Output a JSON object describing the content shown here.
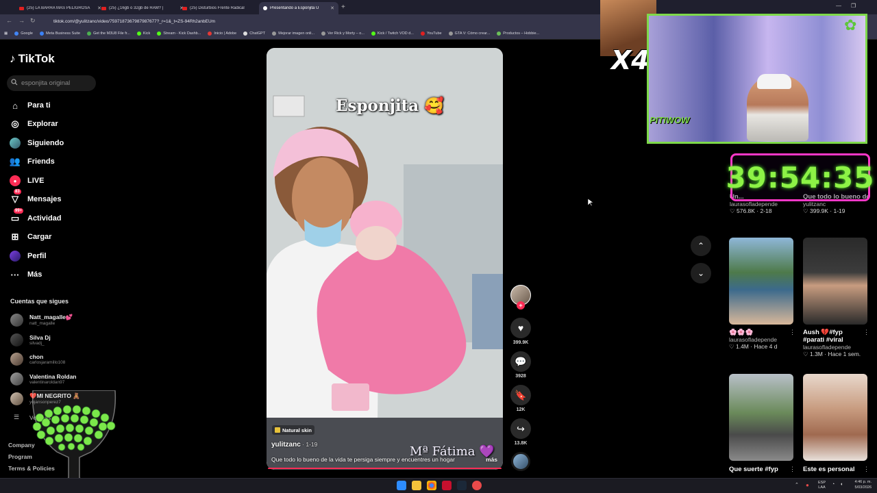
{
  "browser": {
    "tabs": [
      {
        "label": "(25) LA BARRA MAS PELIGROSA",
        "icon": "youtube-icon"
      },
      {
        "label": "(25) ¿16gb o 32gb de RAM? | ",
        "icon": "youtube-icon"
      },
      {
        "label": "(25) Disturbios Frente Radical",
        "icon": "youtube-icon"
      },
      {
        "label": "Presentando a Esponjita U",
        "icon": "tiktok-icon",
        "active": true
      }
    ],
    "url": "tiktok.com/@yulitzanc/video/7597187367987987677?_r=1&_t=ZS-94Rh2anbEUm",
    "bookmarks": [
      "Google",
      "Meta Business Suite",
      "Get the M3U8 File fr...",
      "Kick",
      "Stream - Kick Dashb...",
      "Inicio | Adobe",
      "ChatGPT",
      "Mejorar imagen onli...",
      "Ver Rick y Morty – o...",
      "Kick / Twitch VOD d...",
      "YouTube",
      "GTA V: Cómo crear...",
      "Productos – Hobbie..."
    ]
  },
  "tiktok": {
    "brand": "TikTok",
    "search_placeholder": "esponjita original",
    "nav": [
      {
        "label": "Para ti",
        "icon": "home-icon"
      },
      {
        "label": "Explorar",
        "icon": "compass-icon"
      },
      {
        "label": "Siguiendo",
        "icon": "following-avatar-icon"
      },
      {
        "label": "Friends",
        "icon": "friends-icon"
      },
      {
        "label": "LIVE",
        "icon": "live-icon"
      },
      {
        "label": "Mensajes",
        "icon": "messages-icon",
        "badge": "83"
      },
      {
        "label": "Actividad",
        "icon": "activity-icon",
        "badge": "99+"
      },
      {
        "label": "Cargar",
        "icon": "upload-icon"
      },
      {
        "label": "Perfil",
        "icon": "profile-icon"
      },
      {
        "label": "Más",
        "icon": "more-icon"
      }
    ],
    "following_title": "Cuentas que sigues",
    "following": [
      {
        "name": "Natt_magalle💕",
        "handle": "natt_magalle"
      },
      {
        "name": "Silva Dj",
        "handle": "silvadj_"
      },
      {
        "name": "chon",
        "handle": "carlosjaramillo108"
      },
      {
        "name": "Valentina Roldan",
        "handle": "valentinaroldan97"
      },
      {
        "name": "❤️MI NEGRITO 🧸",
        "handle": "yojansonperez7"
      }
    ],
    "see_more": "Ver más",
    "footer": [
      "Company",
      "Program",
      "Terms & Policies"
    ],
    "video": {
      "overlay_title": "Esponjita 🥰",
      "signature": "Mª Fátima 💜",
      "tag": "Natural skin",
      "author": "yulitzanc",
      "date": " · 1-19",
      "description": "Que todo lo bueno de la vida te persiga siempre y encuentres un hogar",
      "more": "más",
      "likes": "399.9K",
      "comments": "3928",
      "saves": "12K",
      "shares": "13.8K"
    },
    "grid": [
      {
        "title": "Un...",
        "author": "laurasofladepende",
        "stats": "576.8K · 2-18"
      },
      {
        "title": "Que todo lo bueno de la vida te...",
        "author": "yulitzanc",
        "stats": "399.9K · 1-19"
      },
      {
        "title": "🌸🌸🌸",
        "author": "laurasofladepende",
        "stats": "1.4M · Hace 4 d"
      },
      {
        "title": "Aush 💔#fyp",
        "subtitle": "#parati #viral",
        "author": "laurasofladepende",
        "stats": "1.3M · Hace 1 sem."
      },
      {
        "title": "Que suerte #fyp",
        "author": "",
        "stats": ""
      },
      {
        "title": "Este es personal",
        "author": "",
        "stats": ""
      }
    ]
  },
  "stream_overlay": {
    "multiplier": "X4",
    "timer": "39:54:35",
    "cam_logo": "PITIWOW"
  },
  "taskbar": {
    "lang": "ESP",
    "lang2": "LAA",
    "time": "4:46 p. m.",
    "date": "5/03/2026"
  },
  "colors": {
    "accent": "#fe2c55",
    "timer": "#8df246",
    "timer_border": "#ff38c8",
    "cam_border": "#7ed94a"
  }
}
